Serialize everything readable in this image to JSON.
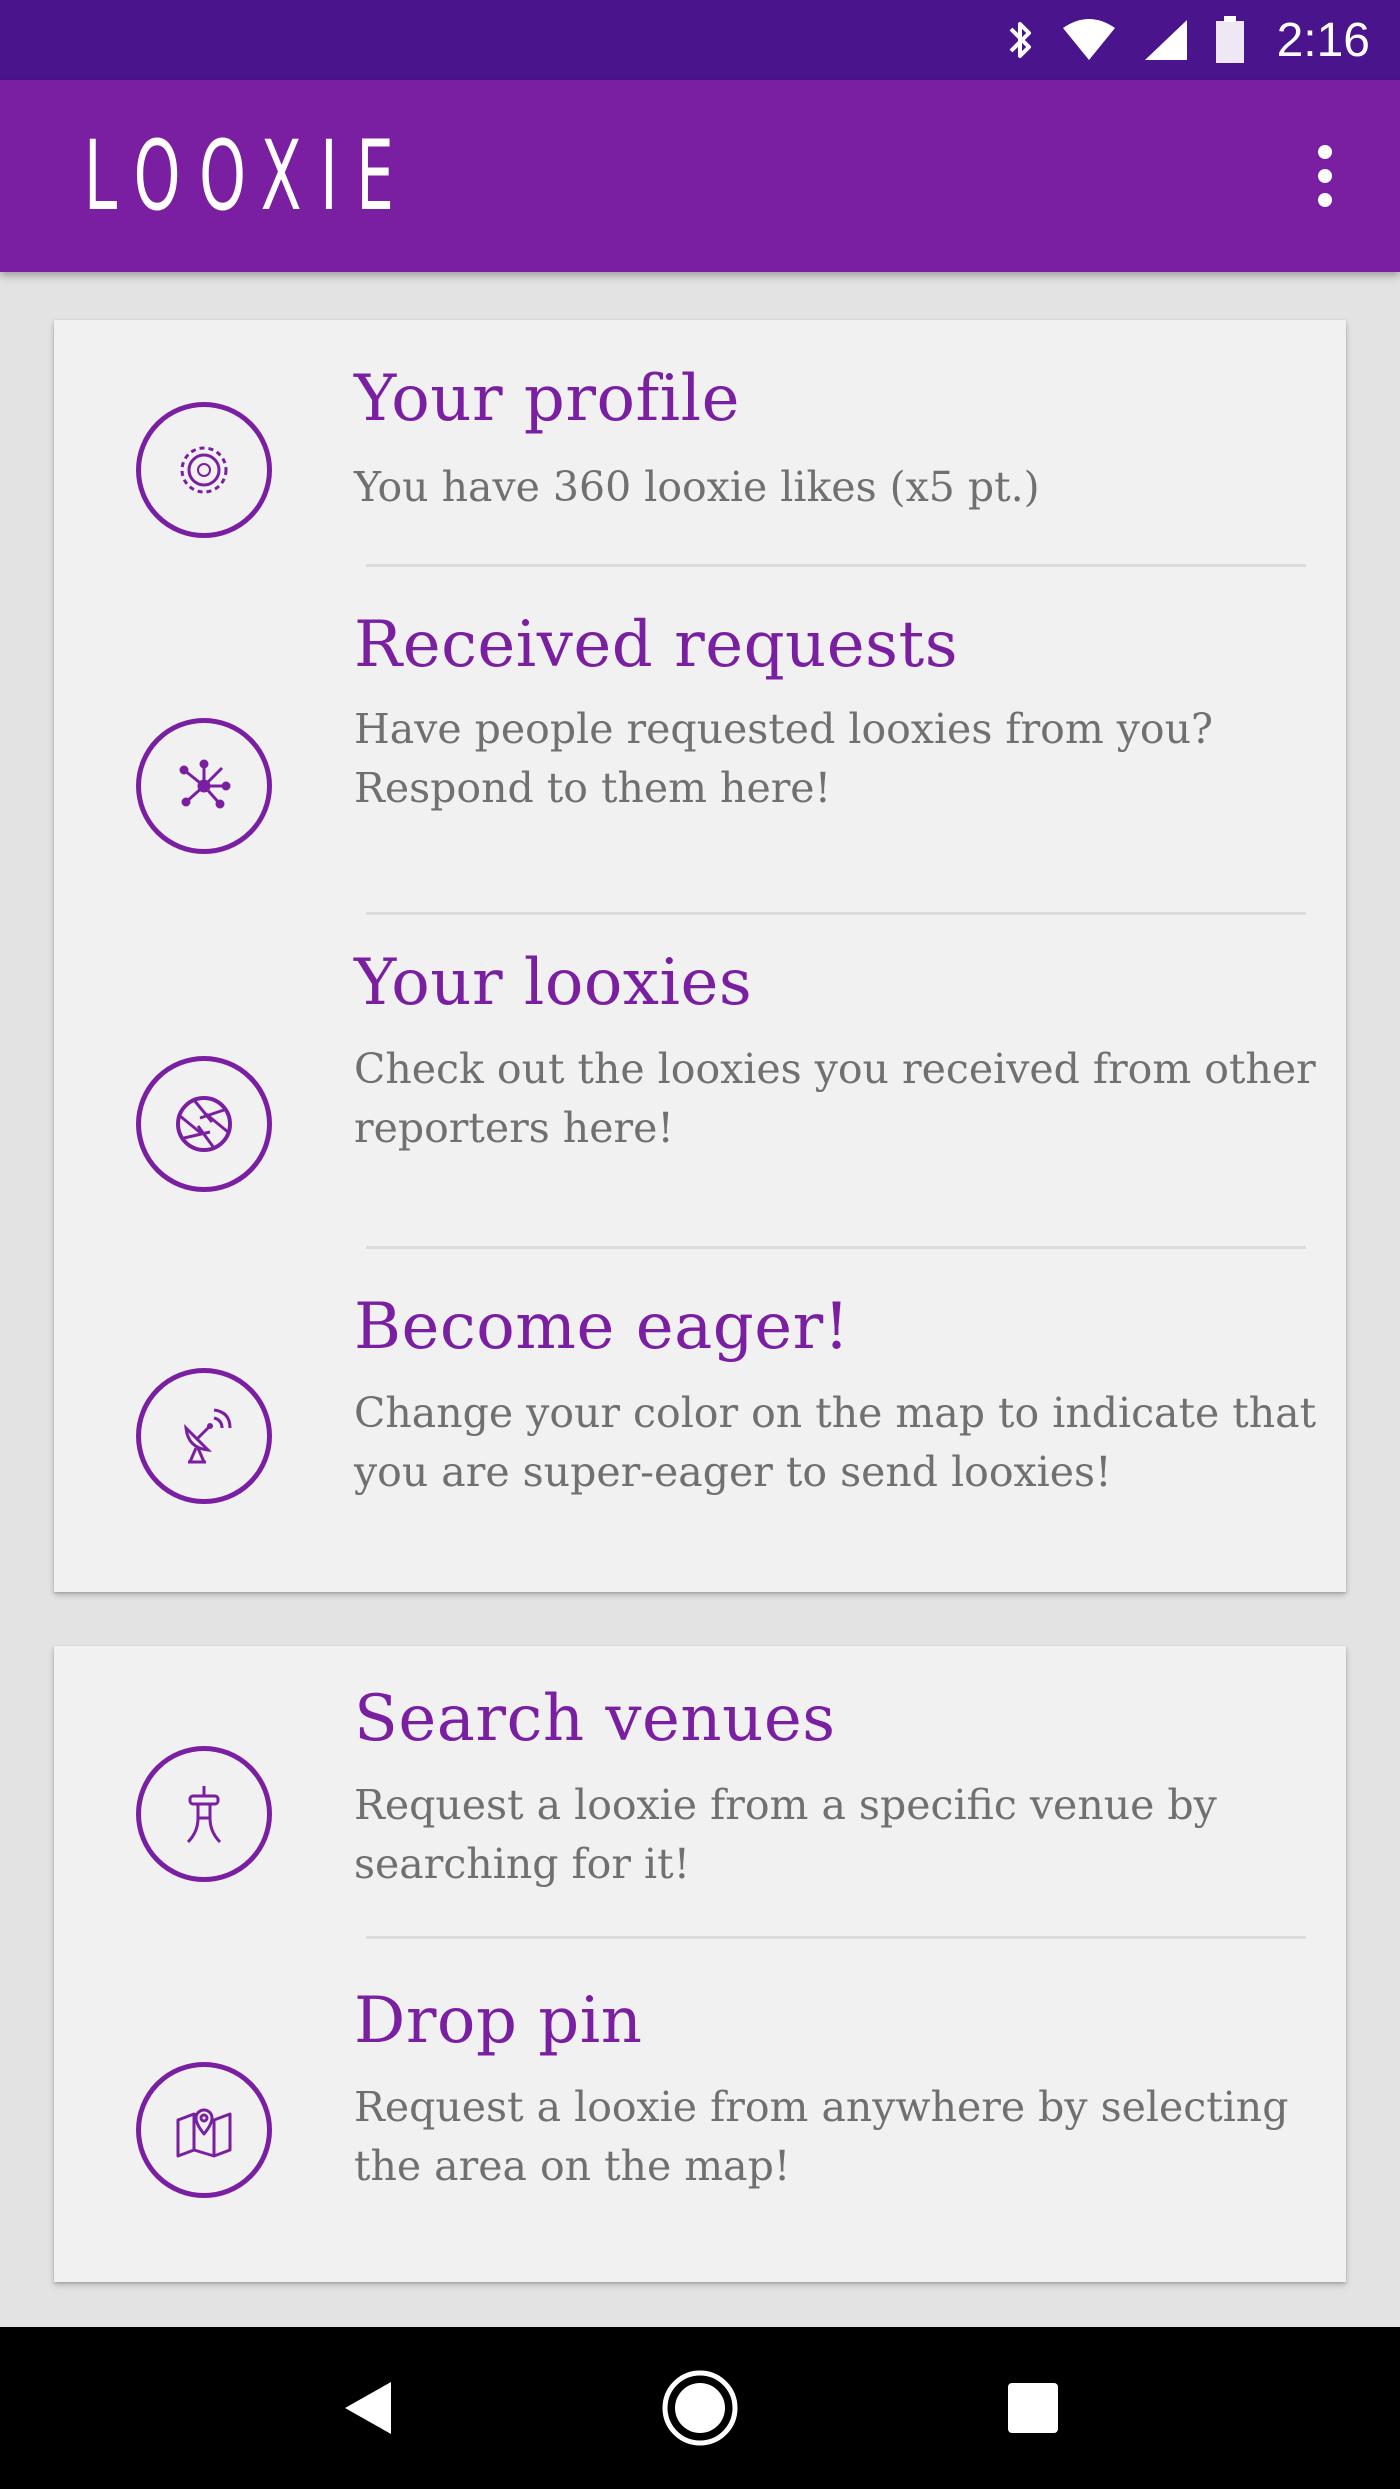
{
  "status_bar": {
    "time": "2:16",
    "icons": [
      "bluetooth-icon",
      "wifi-icon",
      "signal-icon",
      "battery-icon"
    ]
  },
  "app_bar": {
    "title": "LOOXIE",
    "menu_icon": "overflow-menu-icon"
  },
  "colors": {
    "primary_dark": "#4a148c",
    "primary": "#7b1fa2",
    "card_background": "#f1f1f1",
    "description_text": "#707070"
  },
  "menu_cards": [
    {
      "items": [
        {
          "title": "Your profile",
          "description": "You have 360 looxie likes (x5 pt.)",
          "icon": "gear-icon"
        },
        {
          "title": "Received requests",
          "description": "Have people requested looxies from you? Respond to them here!",
          "icon": "network-icon"
        },
        {
          "title": "Your looxies",
          "description": "Check out the looxies you received from other reporters here!",
          "icon": "camera-aperture-icon"
        },
        {
          "title": "Become eager!",
          "description": "Change your color on the map to indicate that you are super-eager to send looxies!",
          "icon": "satellite-dish-icon"
        }
      ]
    },
    {
      "items": [
        {
          "title": "Search venues",
          "description": "Request a looxie from a specific venue by searching for it!",
          "icon": "tower-icon"
        },
        {
          "title": "Drop pin",
          "description": "Request a looxie from anywhere by selecting the area on the map!",
          "icon": "map-pin-icon"
        }
      ]
    }
  ],
  "nav_bar": {
    "buttons": [
      "back-icon",
      "home-icon",
      "recents-icon"
    ]
  }
}
